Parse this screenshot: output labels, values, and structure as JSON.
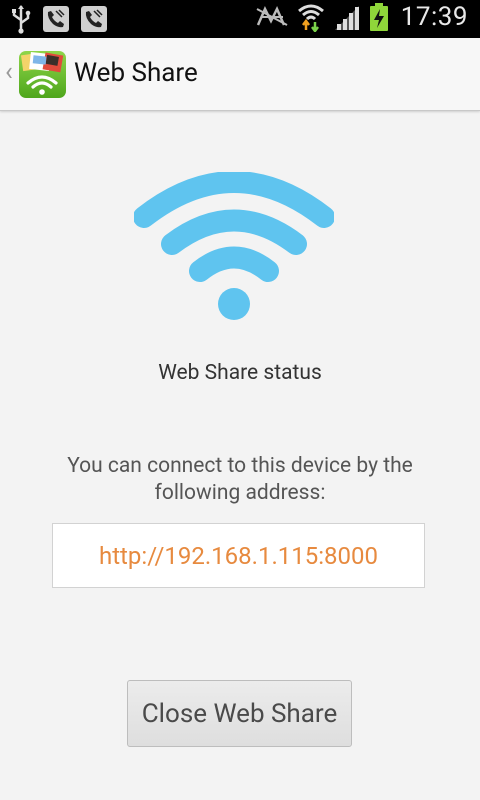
{
  "status_bar": {
    "time": "17:39",
    "notification_icons": [
      "usb-icon",
      "phone-icon",
      "phone-icon"
    ],
    "system_icons": [
      "nfc-icon",
      "wifi-signal-icon",
      "cell-signal-icon",
      "battery-charging-icon"
    ]
  },
  "action_bar": {
    "title": "Web Share"
  },
  "content": {
    "status_text": "Web Share status",
    "description": "You can connect to this device by the following address:",
    "address": "http://192.168.1.115:8000",
    "close_button_label": "Close Web Share"
  },
  "colors": {
    "wifi_blue": "#5fc4ef",
    "address_orange": "#e78a3f",
    "status_bar_bg": "#000000",
    "background": "#f3f3f3"
  }
}
